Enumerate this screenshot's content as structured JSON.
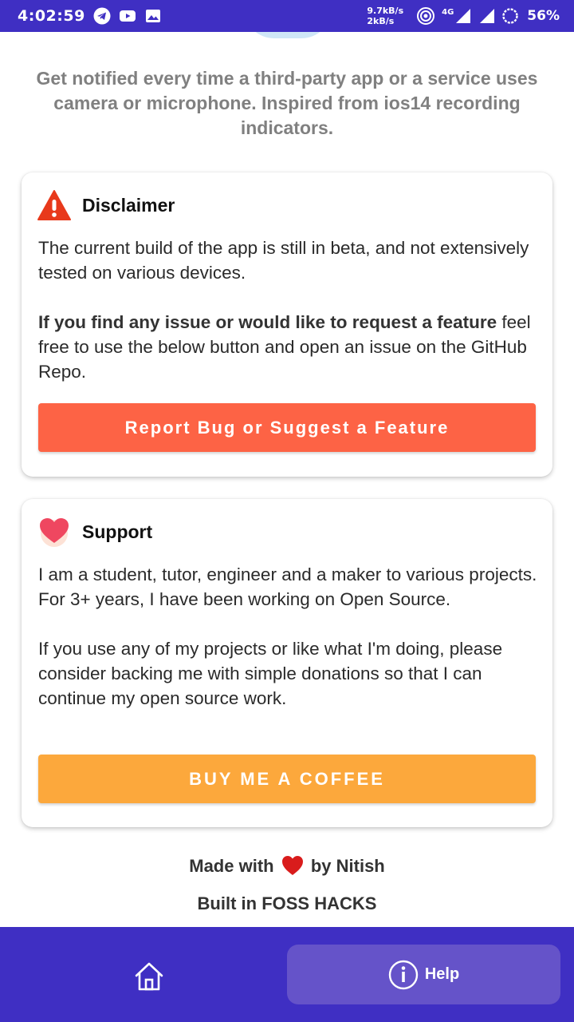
{
  "status_bar": {
    "time": "4:02:59",
    "speed_up": "9.7kB/s",
    "speed_down": "2kB/s",
    "network": "4G",
    "battery": "56%"
  },
  "intro": {
    "text": "Get notified every time a third-party app or a service uses camera or microphone. Inspired from ios14 recording indicators."
  },
  "disclaimer": {
    "title": "Disclaimer",
    "para1": " The current build of the app is still in beta, and not extensively tested on various devices.",
    "para2_bold": " If you find any issue or would like to request a feature",
    "para2_rest": " feel free to use the below button and open an issue on the GitHub Repo.",
    "button_label": "Report Bug or Suggest a Feature",
    "button_color": "#fd6345"
  },
  "support": {
    "title": "Support",
    "para1": "I am a student, tutor, engineer and a maker to various projects. For 3+ years, I have been working on Open Source.",
    "para2": " If you use any of my projects or like what I'm doing, please consider backing me with simple donations so that I can continue my open source work.",
    "button_label": "BUY ME A COFFEE",
    "button_color": "#fca83c"
  },
  "footer": {
    "made_with_prefix": "Made with",
    "made_with_suffix": "by Nitish",
    "built_in": "Built in FOSS HACKS"
  },
  "bottom_nav": {
    "home_icon": "home-icon",
    "help_label": "Help",
    "accent": "#3f2fc3"
  }
}
